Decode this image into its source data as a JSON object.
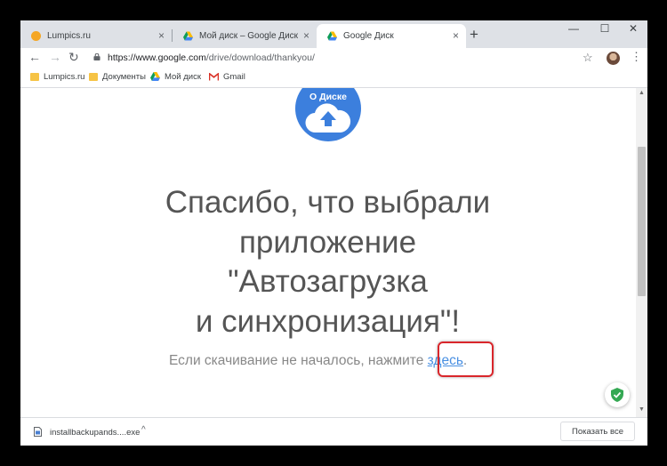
{
  "tabs": [
    {
      "title": "Lumpics.ru",
      "icon": "lumpics-favicon",
      "color": "#f5a623",
      "close": "×"
    },
    {
      "title": "Мой диск – Google Диск",
      "icon": "google-drive-favicon",
      "close": "×"
    },
    {
      "title": "Google Диск",
      "icon": "google-drive-favicon",
      "close": "×",
      "active": true
    }
  ],
  "new_tab": "+",
  "window_controls": {
    "minimize": "—",
    "maximize": "☐",
    "close": "✕"
  },
  "toolbar": {
    "back": "←",
    "forward": "→",
    "reload": "↻",
    "url_host": "https://www.google.com",
    "url_path": "/drive/download/thankyou/",
    "star": "☆",
    "menu": "⋮"
  },
  "bookmarks": [
    {
      "label": "Lumpics.ru",
      "icon": "folder-icon"
    },
    {
      "label": "Документы",
      "icon": "folder-icon"
    },
    {
      "label": "Мой диск",
      "icon": "google-drive-icon"
    },
    {
      "label": "Gmail",
      "icon": "gmail-icon"
    }
  ],
  "page": {
    "badge_text": "О Диске",
    "headline_lines": [
      "Спасибо, что выбрали",
      "приложение",
      "\"Автозагрузка",
      "и синхронизация\"!"
    ],
    "subline_prefix": "Если скачивание не началось, нажмите ",
    "subline_link": "здесь",
    "subline_suffix": "."
  },
  "scrollbar": {
    "up": "▲",
    "down": "▼",
    "position": 0.35
  },
  "download_bar": {
    "filename": "installbackupands....exe",
    "chevron": "^",
    "show_all": "Показать все",
    "close": "✕"
  },
  "colors": {
    "drive_blue": "#3c7fdd",
    "link_blue": "#4a90e2",
    "highlight_red": "#d9262b",
    "shield_green": "#34a853"
  }
}
